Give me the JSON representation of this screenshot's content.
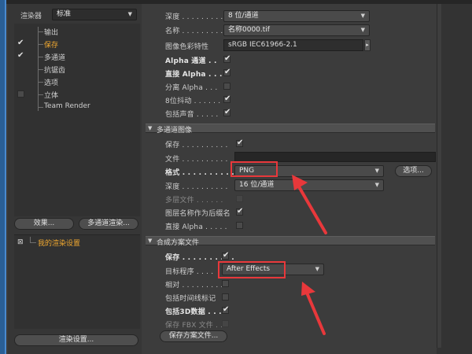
{
  "left": {
    "renderer_label": "渲染器",
    "renderer_value": "标准",
    "tree_items": [
      {
        "label": "输出",
        "checked": false,
        "box": false,
        "active": false
      },
      {
        "label": "保存",
        "checked": true,
        "box": false,
        "active": true
      },
      {
        "label": "多通道",
        "checked": true,
        "box": false,
        "active": false
      },
      {
        "label": "抗锯齿",
        "checked": false,
        "box": false,
        "active": false
      },
      {
        "label": "选项",
        "checked": false,
        "box": false,
        "active": false
      },
      {
        "label": "立体",
        "checked": false,
        "box": true,
        "active": false
      },
      {
        "label": "Team Render",
        "checked": false,
        "box": false,
        "active": false
      }
    ],
    "effects_button": "效果...",
    "multipass_button": "多通道渲染...",
    "preset_item": "我的渲染设置",
    "render_settings_button": "渲染设置..."
  },
  "regular_image": {
    "depth_label": "深度 . . . . . . . . .",
    "depth_value": "8 位/通道",
    "name_label": "名称 . . . . . . . . .",
    "name_value": "名称0000.tif",
    "profile_label": "图像色彩特性",
    "profile_value": "sRGB IEC61966-2.1",
    "alpha_label": "Alpha 通道 . .",
    "straight_alpha_label": "直接 Alpha . . .",
    "separate_alpha_label": "分离 Alpha . . .",
    "dither_label": "8位抖动 . . . . . .",
    "sound_label": "包括声音 . . . . ."
  },
  "multipass": {
    "section_title": "多通道图像",
    "save_label": "保存 . . . . . . . . . .",
    "file_label": "文件 . . . . . . . . . .",
    "format_label": "格式 . . . . . . . . . .",
    "format_value": "PNG",
    "options_button": "选项...",
    "depth_label": "深度 . . . . . . . . . .",
    "depth_value": "16 位/通道",
    "multilayer_label": "多层文件 . . . . . .",
    "layer_name_label": "图层名称作为后缀名",
    "straight_alpha_label": "直接 Alpha . . . . ."
  },
  "compositing": {
    "section_title": "合成方案文件",
    "save_label": "保存 . . . . . . . . . .",
    "target_label": "目标程序 . . . .",
    "target_value": "After Effects",
    "relative_label": "相对 . . . . . . . . . .",
    "timeline_label": "包括时间线标记",
    "include3d_label": "包括3D数据 . . .",
    "fbx_label": "保存 FBX 文件 . .",
    "save_project_button": "保存方案文件..."
  },
  "colors": {
    "annotation": "#e8383b",
    "active_item": "#f0a830"
  }
}
